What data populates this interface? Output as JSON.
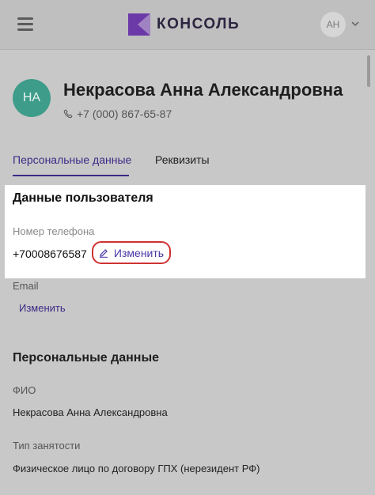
{
  "header": {
    "logo_text": "КОНСОЛЬ",
    "user_initials": "АН"
  },
  "profile": {
    "initials": "НА",
    "name": "Некрасова Анна Александровна",
    "phone": "+7 (000) 867-65-87"
  },
  "tabs": [
    {
      "label": "Персональные данные",
      "active": true
    },
    {
      "label": "Реквизиты",
      "active": false
    }
  ],
  "user_data": {
    "title": "Данные пользователя",
    "phone_label": "Номер телефона",
    "phone_value": "+70008676587",
    "phone_edit_label": "Изменить",
    "email_label": "Email",
    "email_edit_label": "Изменить"
  },
  "personal": {
    "title": "Персональные данные",
    "fio_label": "ФИО",
    "fio_value": "Некрасова Анна Александровна",
    "employment_label": "Тип занятости",
    "employment_value": "Физическое лицо по договору ГПХ (нерезидент РФ)"
  },
  "colors": {
    "accent": "#3d2a86",
    "avatar": "#3e9c8a",
    "highlight_border": "#d03232",
    "logo": "#6b3aa8"
  }
}
